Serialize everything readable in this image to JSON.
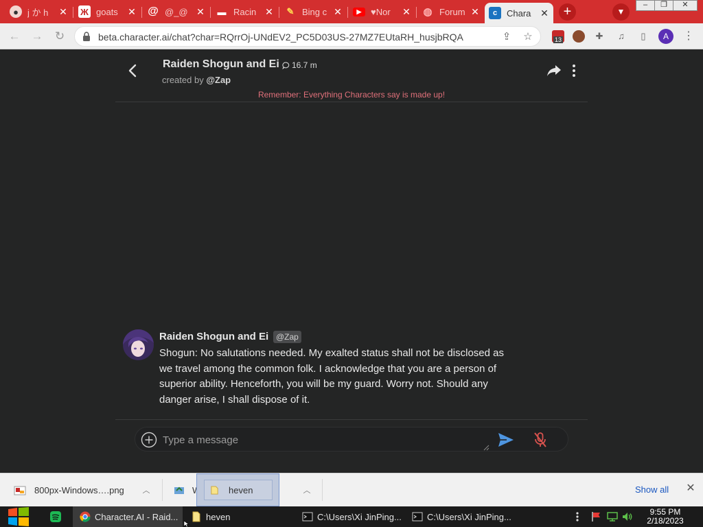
{
  "browser": {
    "tabs": [
      {
        "title": "j か h",
        "icon": "anime-avatar-icon",
        "active": false
      },
      {
        "title": "goats",
        "icon": "goat-icon",
        "active": false
      },
      {
        "title": "@_@",
        "icon": "at-sign-icon",
        "active": false
      },
      {
        "title": "Racin",
        "icon": "flag-icon",
        "active": false
      },
      {
        "title": "Bing c",
        "icon": "bing-icon",
        "active": false
      },
      {
        "title": "♥Nor",
        "icon": "youtube-icon",
        "active": false
      },
      {
        "title": "Forum",
        "icon": "globe-icon",
        "active": false
      },
      {
        "title": "Chara",
        "icon": "character-ai-icon",
        "active": true
      }
    ],
    "url": "beta.character.ai/chat?char=RQrrOj-UNdEV2_PC5D03US-27MZ7EUtaRH_husjbRQA",
    "extension_badge": "13",
    "profile_initial": "A"
  },
  "chat": {
    "character_name": "Raiden Shogun and Ei",
    "chat_count": "16.7 m",
    "created_by_label": "created by",
    "creator": "@Zap",
    "disclaimer": "Remember: Everything Characters say is made up!",
    "message": {
      "author": "Raiden Shogun and Ei",
      "handle": "@Zap",
      "text": "Shogun: No salutations needed. My exalted status shall not be disclosed as we travel among the common folk. I acknowledge that you are a person of superior ability. Henceforth, you will be my guard. Worry not. Should any danger arise, I shall dispose of it."
    },
    "input_placeholder": "Type a message"
  },
  "downloads": {
    "items": [
      {
        "name": "800px-Windows….png"
      },
      {
        "name": "W"
      },
      {
        "name": "heven"
      }
    ],
    "show_all": "Show all"
  },
  "taskbar": {
    "items": [
      {
        "label": "Character.AI - Raid..."
      },
      {
        "label": "heven"
      },
      {
        "label": "C:\\Users\\Xi JinPing..."
      },
      {
        "label": "C:\\Users\\Xi JinPing..."
      }
    ],
    "time": "9:55 PM",
    "date": "2/18/2023"
  }
}
